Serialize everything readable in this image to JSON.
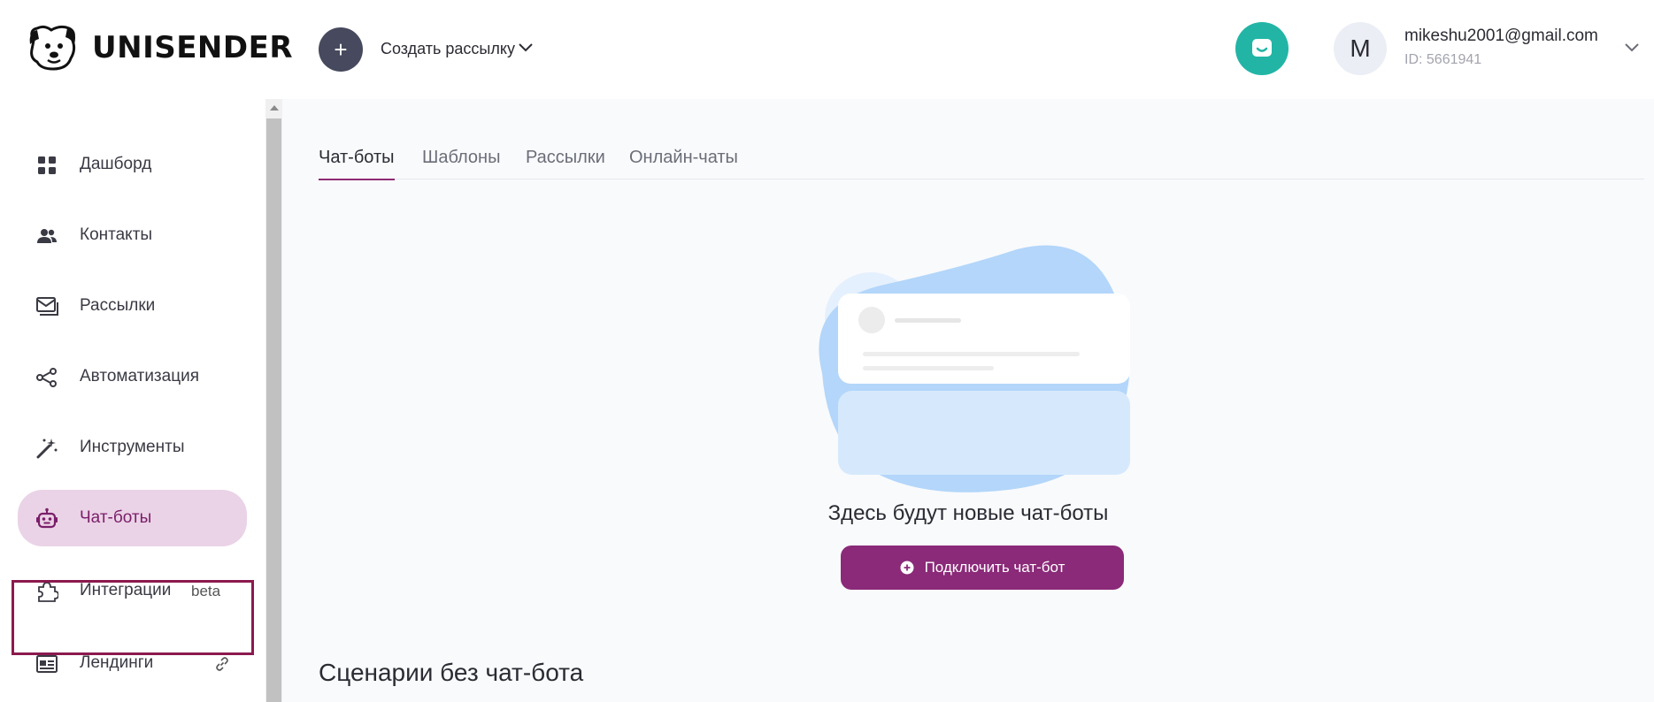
{
  "header": {
    "logo_text": "UNISENDER",
    "create_button_icon": "plus-icon",
    "create_label": "Создать рассылку",
    "support_icon": "chat-support-icon",
    "avatar_letter": "M",
    "user_email": "mikeshu2001@gmail.com",
    "user_id": "ID: 5661941"
  },
  "sidebar": {
    "items": [
      {
        "label": "Дашборд",
        "icon": "dashboard-icon"
      },
      {
        "label": "Контакты",
        "icon": "contacts-icon"
      },
      {
        "label": "Рассылки",
        "icon": "mail-icon"
      },
      {
        "label": "Автоматизация",
        "icon": "automation-icon"
      },
      {
        "label": "Инструменты",
        "icon": "magic-wand-icon"
      },
      {
        "label": "Чат-боты",
        "icon": "robot-icon",
        "active": true
      },
      {
        "label": "Интеграции",
        "icon": "puzzle-icon",
        "tag": "beta"
      },
      {
        "label": "Лендинги",
        "icon": "landing-icon",
        "trailing_icon": "link-icon"
      }
    ]
  },
  "main": {
    "tabs": [
      {
        "label": "Чат-боты",
        "active": true
      },
      {
        "label": "Шаблоны"
      },
      {
        "label": "Рассылки"
      },
      {
        "label": "Онлайн-чаты"
      }
    ],
    "empty_title": "Здесь будут новые чат-боты",
    "connect_button": "Подключить чат-бот",
    "section_title": "Сценарии без чат-бота"
  },
  "colors": {
    "accent": "#8a2a78",
    "active_nav_bg": "#ead3e6",
    "support_teal": "#22b5a5",
    "create_button": "#474a5e",
    "highlight_outline": "#8b1a4e"
  }
}
